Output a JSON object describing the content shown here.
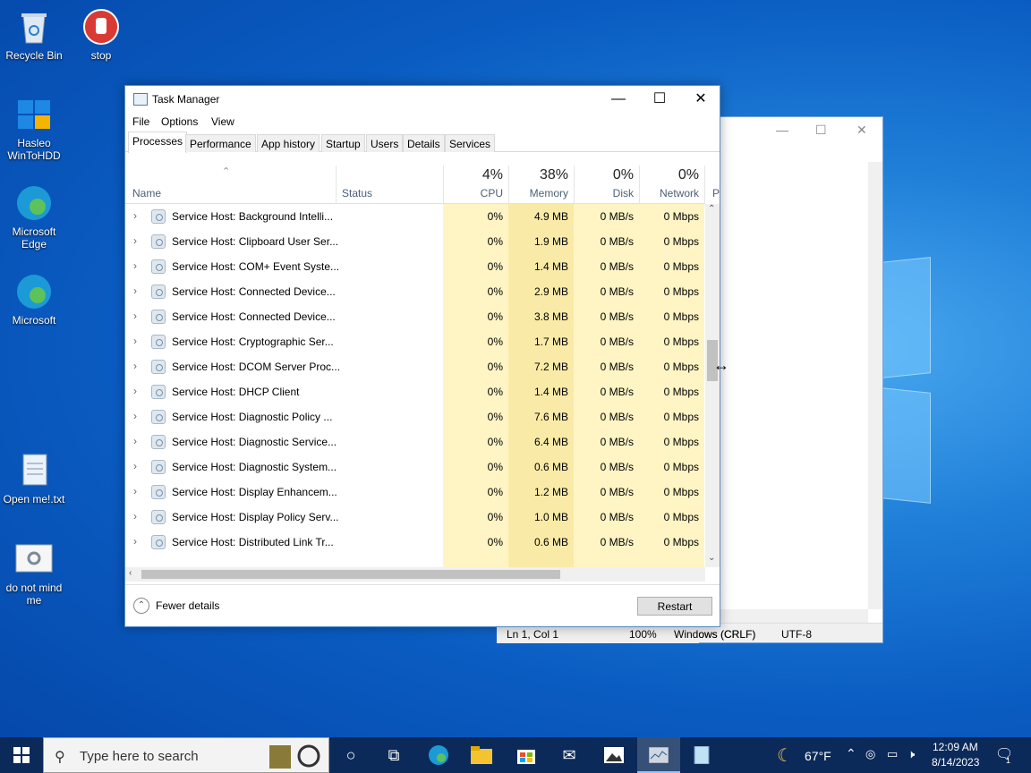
{
  "desktop": {
    "icons": [
      {
        "label": "Recycle Bin"
      },
      {
        "label": "stop"
      },
      {
        "label": "Hasleo WinToHDD"
      },
      {
        "label": "Microsoft Edge"
      },
      {
        "label": "Microsoft"
      },
      {
        "label": "Open me!.txt"
      },
      {
        "label": "do not mind me"
      }
    ]
  },
  "notepad": {
    "status": {
      "position": "Ln 1, Col 1",
      "zoom": "100%",
      "line_ending": "Windows (CRLF)",
      "encoding": "UTF-8"
    }
  },
  "task_manager": {
    "title": "Task Manager",
    "menu": [
      "File",
      "Options",
      "View"
    ],
    "tabs": [
      "Processes",
      "Performance",
      "App history",
      "Startup",
      "Users",
      "Details",
      "Services"
    ],
    "columns": {
      "name": "Name",
      "status": "Status",
      "cpu": {
        "pct": "4%",
        "label": "CPU"
      },
      "memory": {
        "pct": "38%",
        "label": "Memory"
      },
      "disk": {
        "pct": "0%",
        "label": "Disk"
      },
      "network": {
        "pct": "0%",
        "label": "Network"
      },
      "power": "P"
    },
    "rows": [
      {
        "name": "Service Host: Background Intelli...",
        "cpu": "0%",
        "memory": "4.9 MB",
        "disk": "0 MB/s",
        "network": "0 Mbps"
      },
      {
        "name": "Service Host: Clipboard User Ser...",
        "cpu": "0%",
        "memory": "1.9 MB",
        "disk": "0 MB/s",
        "network": "0 Mbps"
      },
      {
        "name": "Service Host: COM+ Event Syste...",
        "cpu": "0%",
        "memory": "1.4 MB",
        "disk": "0 MB/s",
        "network": "0 Mbps"
      },
      {
        "name": "Service Host: Connected Device...",
        "cpu": "0%",
        "memory": "2.9 MB",
        "disk": "0 MB/s",
        "network": "0 Mbps"
      },
      {
        "name": "Service Host: Connected Device...",
        "cpu": "0%",
        "memory": "3.8 MB",
        "disk": "0 MB/s",
        "network": "0 Mbps"
      },
      {
        "name": "Service Host: Cryptographic Ser...",
        "cpu": "0%",
        "memory": "1.7 MB",
        "disk": "0 MB/s",
        "network": "0 Mbps"
      },
      {
        "name": "Service Host: DCOM Server Proc...",
        "cpu": "0%",
        "memory": "7.2 MB",
        "disk": "0 MB/s",
        "network": "0 Mbps"
      },
      {
        "name": "Service Host: DHCP Client",
        "cpu": "0%",
        "memory": "1.4 MB",
        "disk": "0 MB/s",
        "network": "0 Mbps"
      },
      {
        "name": "Service Host: Diagnostic Policy ...",
        "cpu": "0%",
        "memory": "7.6 MB",
        "disk": "0 MB/s",
        "network": "0 Mbps"
      },
      {
        "name": "Service Host: Diagnostic Service...",
        "cpu": "0%",
        "memory": "6.4 MB",
        "disk": "0 MB/s",
        "network": "0 Mbps"
      },
      {
        "name": "Service Host: Diagnostic System...",
        "cpu": "0%",
        "memory": "0.6 MB",
        "disk": "0 MB/s",
        "network": "0 Mbps"
      },
      {
        "name": "Service Host: Display Enhancem...",
        "cpu": "0%",
        "memory": "1.2 MB",
        "disk": "0 MB/s",
        "network": "0 Mbps"
      },
      {
        "name": "Service Host: Display Policy Serv...",
        "cpu": "0%",
        "memory": "1.0 MB",
        "disk": "0 MB/s",
        "network": "0 Mbps"
      },
      {
        "name": "Service Host: Distributed Link Tr...",
        "cpu": "0%",
        "memory": "0.6 MB",
        "disk": "0 MB/s",
        "network": "0 Mbps"
      }
    ],
    "footer": {
      "fewer_details": "Fewer details",
      "restart": "Restart"
    }
  },
  "taskbar": {
    "search_placeholder": "Type here to search",
    "weather": "67°F",
    "time": "12:09 AM",
    "date": "8/14/2023",
    "notification_count": "1"
  }
}
